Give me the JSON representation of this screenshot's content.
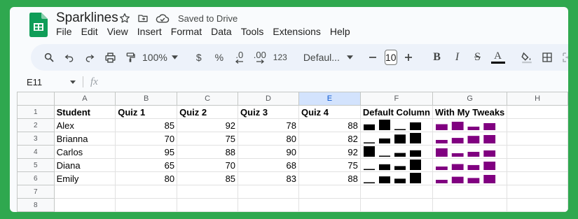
{
  "doc": {
    "title": "Sparklines",
    "saved_status": "Saved to Drive"
  },
  "menu": [
    "File",
    "Edit",
    "View",
    "Insert",
    "Format",
    "Data",
    "Tools",
    "Extensions",
    "Help"
  ],
  "toolbar": {
    "zoom": "100%",
    "currency": "$",
    "percent": "%",
    "decrease_decimal": ".0",
    "increase_decimal": ".00",
    "number_format": "123",
    "font": "Defaul...",
    "font_size": "10",
    "bold": "B",
    "italic": "I",
    "strike": "S",
    "text_color": "A"
  },
  "formula_bar": {
    "name_box": "E11",
    "fx": "fx",
    "content": ""
  },
  "columns": [
    "A",
    "B",
    "C",
    "D",
    "E",
    "F",
    "G",
    "H"
  ],
  "selected_column": "E",
  "rows": [
    [
      "Student",
      "Quiz 1",
      "Quiz 2",
      "Quiz 3",
      "Quiz 4",
      "Default Column",
      "With My Tweaks",
      ""
    ],
    [
      "Alex",
      "85",
      "92",
      "78",
      "88",
      "",
      "",
      ""
    ],
    [
      "Brianna",
      "70",
      "75",
      "80",
      "82",
      "",
      "",
      ""
    ],
    [
      "Carlos",
      "95",
      "88",
      "90",
      "92",
      "",
      "",
      ""
    ],
    [
      "Diana",
      "65",
      "70",
      "68",
      "75",
      "",
      "",
      ""
    ],
    [
      "Emily",
      "80",
      "85",
      "83",
      "88",
      "",
      "",
      ""
    ],
    [
      "",
      "",
      "",
      "",
      "",
      "",
      "",
      ""
    ],
    [
      "",
      "",
      "",
      "",
      "",
      "",
      "",
      ""
    ]
  ],
  "row_numbers": [
    "1",
    "2",
    "3",
    "4",
    "5",
    "6",
    "7",
    "8"
  ],
  "sparklines": {
    "default_color": "#000000",
    "tweak_color": "#800080",
    "values": [
      [
        85,
        92,
        78,
        88
      ],
      [
        70,
        75,
        80,
        82
      ],
      [
        95,
        88,
        90,
        92
      ],
      [
        65,
        70,
        68,
        75
      ],
      [
        80,
        85,
        83,
        88
      ]
    ]
  }
}
